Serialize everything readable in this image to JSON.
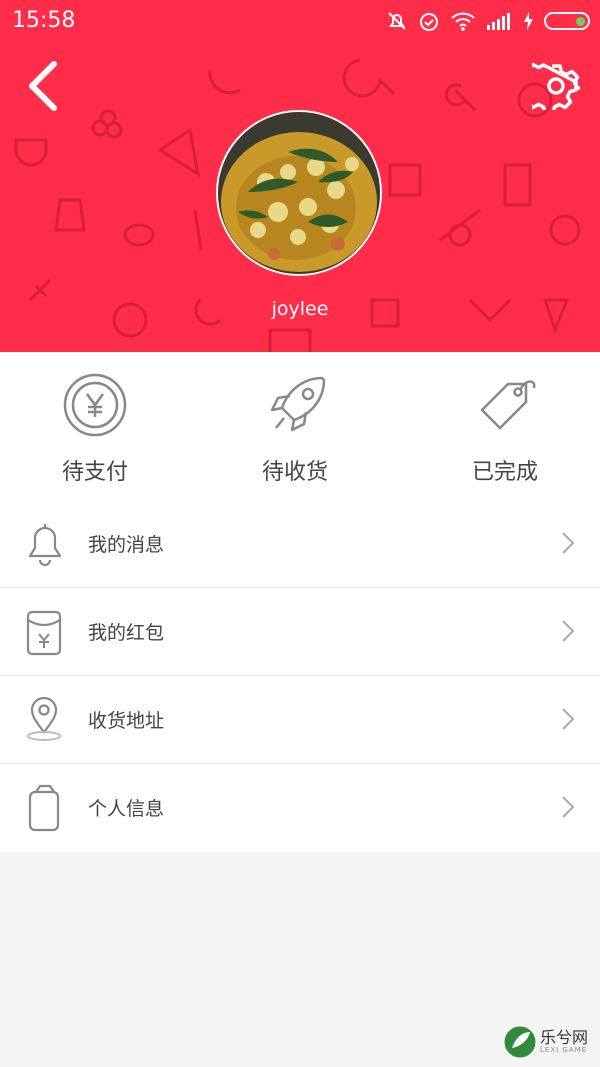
{
  "status_bar": {
    "time": "15:58",
    "icons": [
      "mute-bell-icon",
      "alarm-icon",
      "wifi-icon",
      "signal-icon",
      "charging-icon",
      "battery-icon"
    ]
  },
  "header": {
    "background_color": "#ff2d4a",
    "back_icon": "chevron-left-icon",
    "settings_icon": "gear-icon",
    "username": "joylee"
  },
  "orders": [
    {
      "label": "待支付",
      "icon": "yen-coin-icon"
    },
    {
      "label": "待收货",
      "icon": "rocket-icon"
    },
    {
      "label": "已完成",
      "icon": "tag-icon"
    }
  ],
  "menu": [
    {
      "label": "我的消息",
      "icon": "bell-icon"
    },
    {
      "label": "我的红包",
      "icon": "red-envelope-icon"
    },
    {
      "label": "收货地址",
      "icon": "location-pin-icon"
    },
    {
      "label": "个人信息",
      "icon": "phone-icon"
    }
  ],
  "watermark": {
    "text": "乐兮网",
    "sub": "LEXI GAME"
  }
}
